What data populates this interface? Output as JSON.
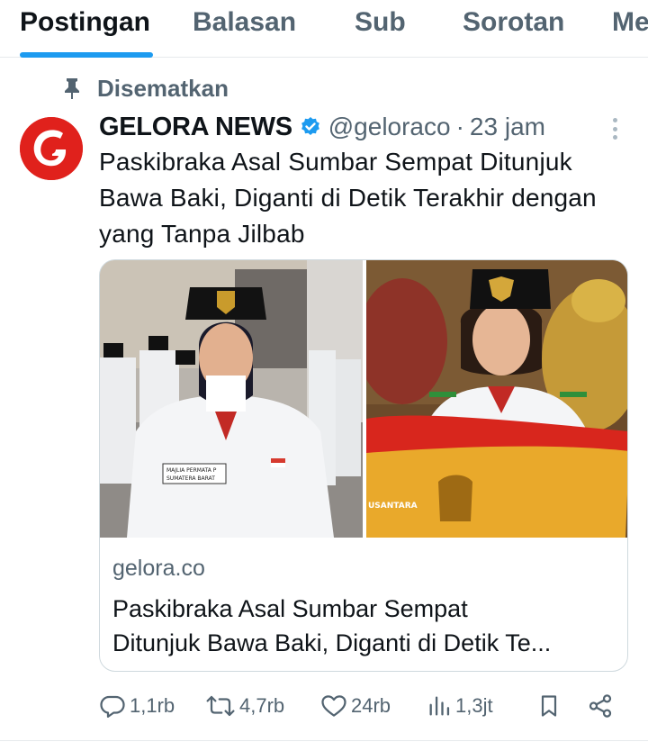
{
  "tabs": [
    {
      "label": "Postingan"
    },
    {
      "label": "Balasan"
    },
    {
      "label": "Sub"
    },
    {
      "label": "Sorotan"
    },
    {
      "label": "Me"
    }
  ],
  "pinned": {
    "label": "Disematkan",
    "icon": "pin-icon"
  },
  "post": {
    "display_name": "GELORA NEWS",
    "handle": "@geloraco",
    "separator": "·",
    "time": "23 jam",
    "text": "Paskibraka Asal Sumbar Sempat Ditunjuk Bawa Baki, Diganti di Detik Terakhir dengan yang Tanpa Jilbab",
    "card": {
      "domain": "gelora.co",
      "title_line1": "Paskibraka Asal Sumbar Sempat",
      "title_line2": "Ditunjuk Bawa Baki, Diganti di Detik Te...",
      "left_badge_line1": "MAJLIA PERMATA P",
      "left_badge_line2": "SUMATERA BARAT",
      "right_caption": "USANTARA"
    },
    "actions": {
      "replies": "1,1rb",
      "reposts": "4,7rb",
      "likes": "24rb",
      "views": "1,3jt"
    }
  },
  "colors": {
    "accent": "#1d9bf0",
    "muted": "#536471",
    "text": "#0f1419",
    "logo_red": "#e0211c"
  }
}
